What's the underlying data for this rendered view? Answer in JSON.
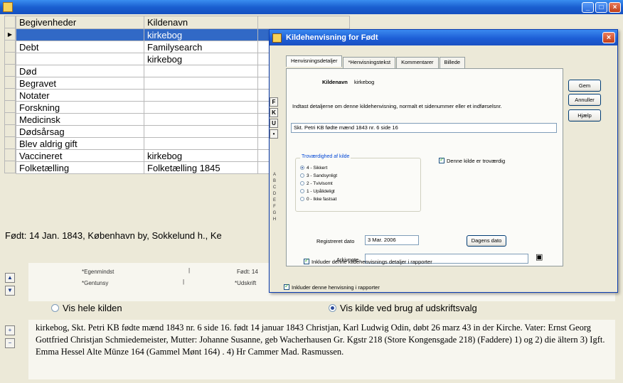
{
  "main": {
    "title": "",
    "columns": [
      "Begivenheder",
      "Kildenavn"
    ],
    "rows": [
      {
        "event": "",
        "source": "kirkebog",
        "selected": true
      },
      {
        "event": "Debt",
        "source": "Familysearch"
      },
      {
        "event": "",
        "source": "kirkebog"
      },
      {
        "event": "Død",
        "source": ""
      },
      {
        "event": "Begravet",
        "source": ""
      },
      {
        "event": "Notater",
        "source": ""
      },
      {
        "event": "Forskning",
        "source": ""
      },
      {
        "event": "Medicinsk",
        "source": ""
      },
      {
        "event": "Dødsårsag",
        "source": ""
      },
      {
        "event": "Blev aldrig gift",
        "source": ""
      },
      {
        "event": "Vaccineret",
        "source": "kirkebog"
      },
      {
        "event": "Folketælling",
        "source": "Folketælling 1845"
      }
    ],
    "summary": "Født: 14 Jan. 1843, København by, Sokkelund h., Ke",
    "citation_labels": [
      "*Egenmindst",
      "*Gentunsy",
      "Født: 14",
      "*Udskrift"
    ],
    "radio_full": "Vis hele kilden",
    "radio_print": "Vis kilde ved brug af udskriftsvalg",
    "citation_text": "kirkebog, Skt. Petri KB fødte mænd 1843 nr. 6 side 16. født 14 januar 1843 Christjan, Karl Ludwig Odin, døbt 26 marz 43 in der Kirche. Vater: Ernst Georg Gottfried Christjan Schmiedemeister, Mutter: Johanne Susanne, geb Wacherhausen Gr. Kgstr 218 (Store Kongensgade 218) (Faddere) 1) og 2) die ältern 3) Igft. Emma Hessel Alte Münze 164 (Gammel Mønt 164) . 4) Hr Cammer Mad. Rasmussen."
  },
  "dialog": {
    "title": "Kildehenvisning for Født",
    "tabs": [
      "Henvisningsdetaljer",
      "*Henvisningstekst",
      "Kommentarer",
      "Billede"
    ],
    "buttons": {
      "ok": "Gem",
      "cancel": "Annuller",
      "help": "Hjælp"
    },
    "source_label": "Kildenavn",
    "source_value": "kirkebog",
    "instruction": "Indtast detaljerne om denne kildehenvisning, normalt et sidenummer eller et indførselsnr.",
    "detail_value": "Skt. Petri KB fødte mænd 1843 nr. 6 side 16",
    "group_label": "Troværdighed af kilde",
    "reliability": [
      "4 - Sikkert",
      "3 - Sandsynligt",
      "2 - Tvivlsomt",
      "1 - Upålideligt",
      "0 - Ikke fastsat"
    ],
    "reliability_selected": 0,
    "trusted_label": "Denne kilde er troværdig",
    "date_label": "Registreret dato",
    "date_value": "3 Mar. 2006",
    "today_button": "Dagens dato",
    "ref_label": "Arkivnote",
    "ref_value": "",
    "include_label": "Inkluder denne kildehenvisnings detaljer i rapporter",
    "footer_label": "Inkluder denne henvisning i rapporter",
    "format_buttons": [
      "F",
      "K",
      "U",
      "•"
    ],
    "letters": [
      "A",
      "B",
      "C",
      "D",
      "E",
      "F",
      "G",
      "H"
    ]
  }
}
